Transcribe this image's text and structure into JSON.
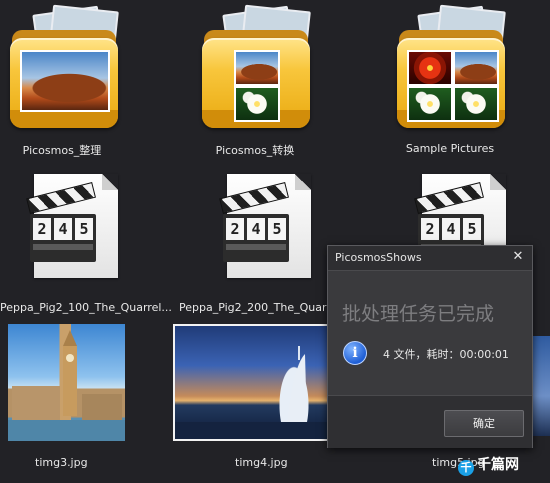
{
  "folders": [
    {
      "name": "Picosmos_整理"
    },
    {
      "name": "Picosmos_转换"
    },
    {
      "name": "Sample Pictures"
    }
  ],
  "videos": [
    {
      "name": "Peppa_Pig2_100_The_Quarrel...",
      "digits": [
        "2",
        "4",
        "5"
      ]
    },
    {
      "name": "Peppa_Pig2_200_The_Quarre",
      "digits": [
        "2",
        "4",
        "5"
      ]
    },
    {
      "digits": [
        "2",
        "4",
        "5"
      ]
    }
  ],
  "images": [
    {
      "name": "timg3.jpg"
    },
    {
      "name": "timg4.jpg"
    },
    {
      "name": "timg5.jpg"
    }
  ],
  "dialog": {
    "title": "PicosmosShows",
    "close_label": "✕",
    "headline": "批处理任务已完成",
    "info_glyph": "i",
    "message": "4 文件，耗时：00:00:01",
    "ok_label": "确定"
  },
  "watermark": {
    "badge": "千",
    "text": "千篇网"
  },
  "colors": {
    "background": "#222226",
    "dialog_bg": "#3a3a3d",
    "folder": "#f8c63c"
  }
}
